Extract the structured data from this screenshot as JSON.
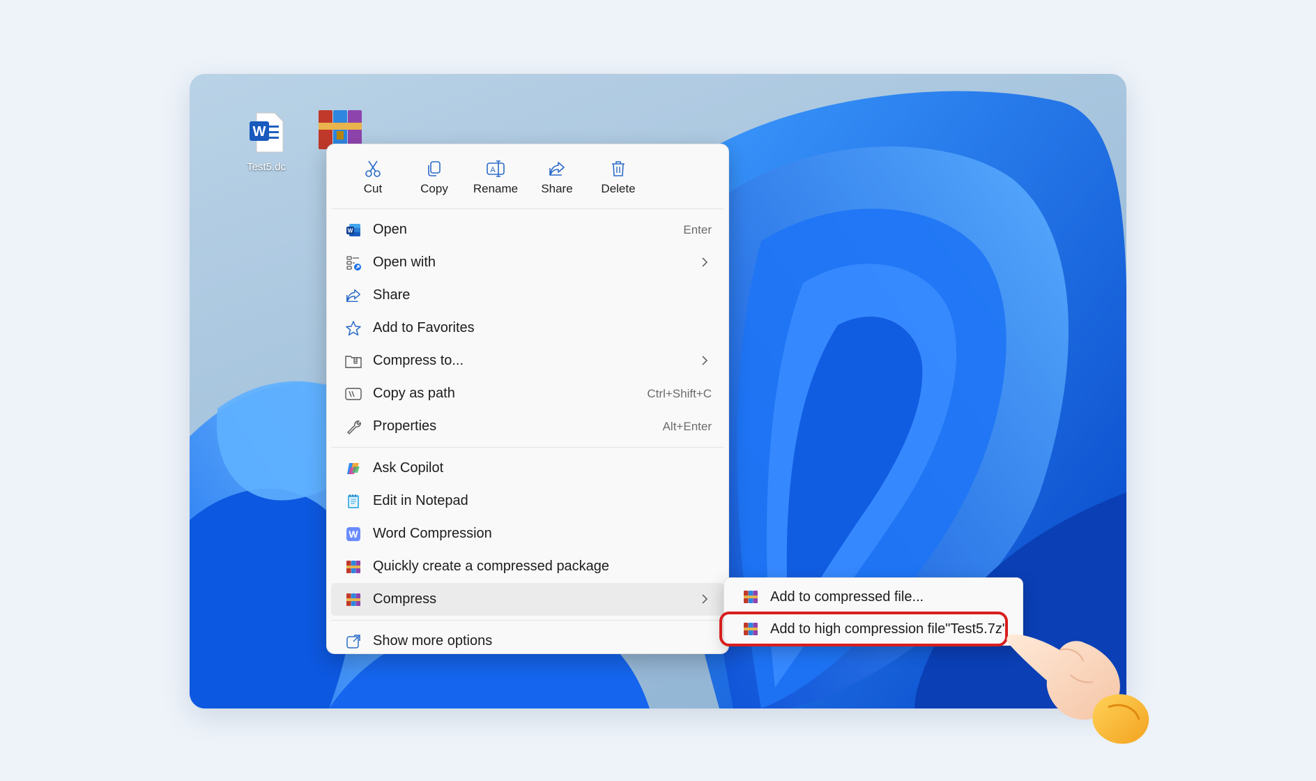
{
  "desktop": {
    "icons": [
      {
        "name": "word-document-icon",
        "label": "Test5.dc"
      },
      {
        "name": "archive-icon",
        "label": ""
      }
    ]
  },
  "context_menu": {
    "quick_actions": [
      {
        "label": "Cut",
        "icon": "scissors-icon"
      },
      {
        "label": "Copy",
        "icon": "copy-icon"
      },
      {
        "label": "Rename",
        "icon": "rename-icon"
      },
      {
        "label": "Share",
        "icon": "share-icon"
      },
      {
        "label": "Delete",
        "icon": "trash-icon"
      }
    ],
    "items": [
      {
        "label": "Open",
        "shortcut": "Enter",
        "icon": "word-app-icon"
      },
      {
        "label": "Open with",
        "submenu": true,
        "icon": "open-with-icon"
      },
      {
        "label": "Share",
        "icon": "share-icon"
      },
      {
        "label": "Add to Favorites",
        "icon": "star-icon"
      },
      {
        "label": "Compress to...",
        "submenu": true,
        "icon": "zip-folder-icon"
      },
      {
        "label": "Copy as path",
        "shortcut": "Ctrl+Shift+C",
        "icon": "path-icon"
      },
      {
        "label": "Properties",
        "shortcut": "Alt+Enter",
        "icon": "wrench-icon"
      },
      {
        "label": "Ask Copilot",
        "icon": "copilot-icon"
      },
      {
        "label": "Edit in Notepad",
        "icon": "notepad-icon"
      },
      {
        "label": "Word Compression",
        "icon": "word-compression-icon"
      },
      {
        "label": "Quickly create a compressed package",
        "icon": "winrar-icon"
      },
      {
        "label": "Compress",
        "submenu": true,
        "icon": "winrar-icon"
      },
      {
        "label": "Show more options",
        "icon": "more-options-icon"
      }
    ]
  },
  "compress_submenu": {
    "items": [
      {
        "label": "Add to compressed file...",
        "icon": "winrar-icon"
      },
      {
        "label": "Add to high compression file\"Test5.7z\"",
        "icon": "winrar-icon",
        "highlighted": true
      }
    ]
  },
  "colors": {
    "highlight_border": "#d81e1e",
    "wallpaper_blue": "#0a5ee8",
    "accent": "#1d62c9"
  }
}
